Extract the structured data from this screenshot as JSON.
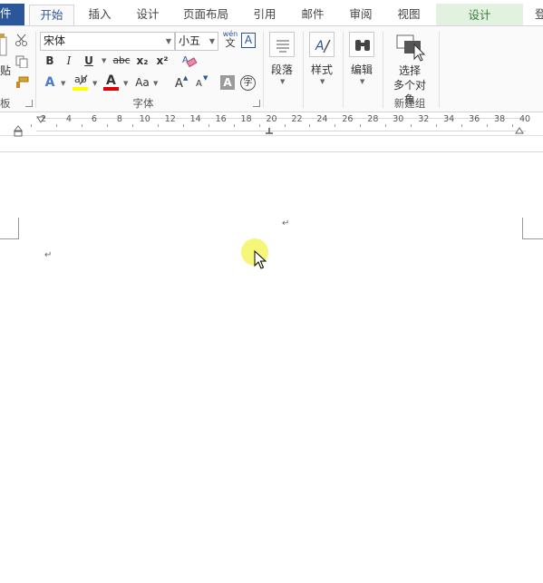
{
  "tabs": {
    "file": "件",
    "home": "开始",
    "insert": "插入",
    "design": "设计",
    "layout": "页面布局",
    "references": "引用",
    "mailings": "邮件",
    "review": "审阅",
    "view": "视图",
    "context_design": "设计",
    "login": "登"
  },
  "clipboard": {
    "paste_label": "贴",
    "group_label": "板"
  },
  "font": {
    "font_name": "宋体",
    "font_size": "小五",
    "phonetic_top": "wén",
    "phonetic_bottom": "文",
    "border_char": "A",
    "bold": "B",
    "italic": "I",
    "underline": "U",
    "strikethrough": "abc",
    "subscript": "x₂",
    "superscript": "x²",
    "text_effects": "A",
    "highlight": "ab",
    "font_color": "A",
    "change_case": "Aa",
    "grow": "A",
    "shrink": "A",
    "shading": "A",
    "enclose": "字",
    "group_label": "字体"
  },
  "paragraph": {
    "label": "段落"
  },
  "styles": {
    "label": "样式"
  },
  "editing": {
    "label": "编辑"
  },
  "new_group": {
    "select_label_1": "选择",
    "select_label_2": "多个对象",
    "group_label": "新建组"
  },
  "ruler": {
    "numbers": [
      "2",
      "4",
      "6",
      "8",
      "10",
      "12",
      "14",
      "16",
      "18",
      "20",
      "22",
      "24",
      "26",
      "28",
      "30",
      "32",
      "34",
      "36",
      "38",
      "40"
    ]
  },
  "document": {
    "para_mark": "↵"
  },
  "colors": {
    "file_tab": "#2b579a",
    "context_tab_bg": "#e3f1e0",
    "highlight_yellow": "#ffff00",
    "font_color_red": "#e00000",
    "cursor_halo": "#f5f56a"
  }
}
